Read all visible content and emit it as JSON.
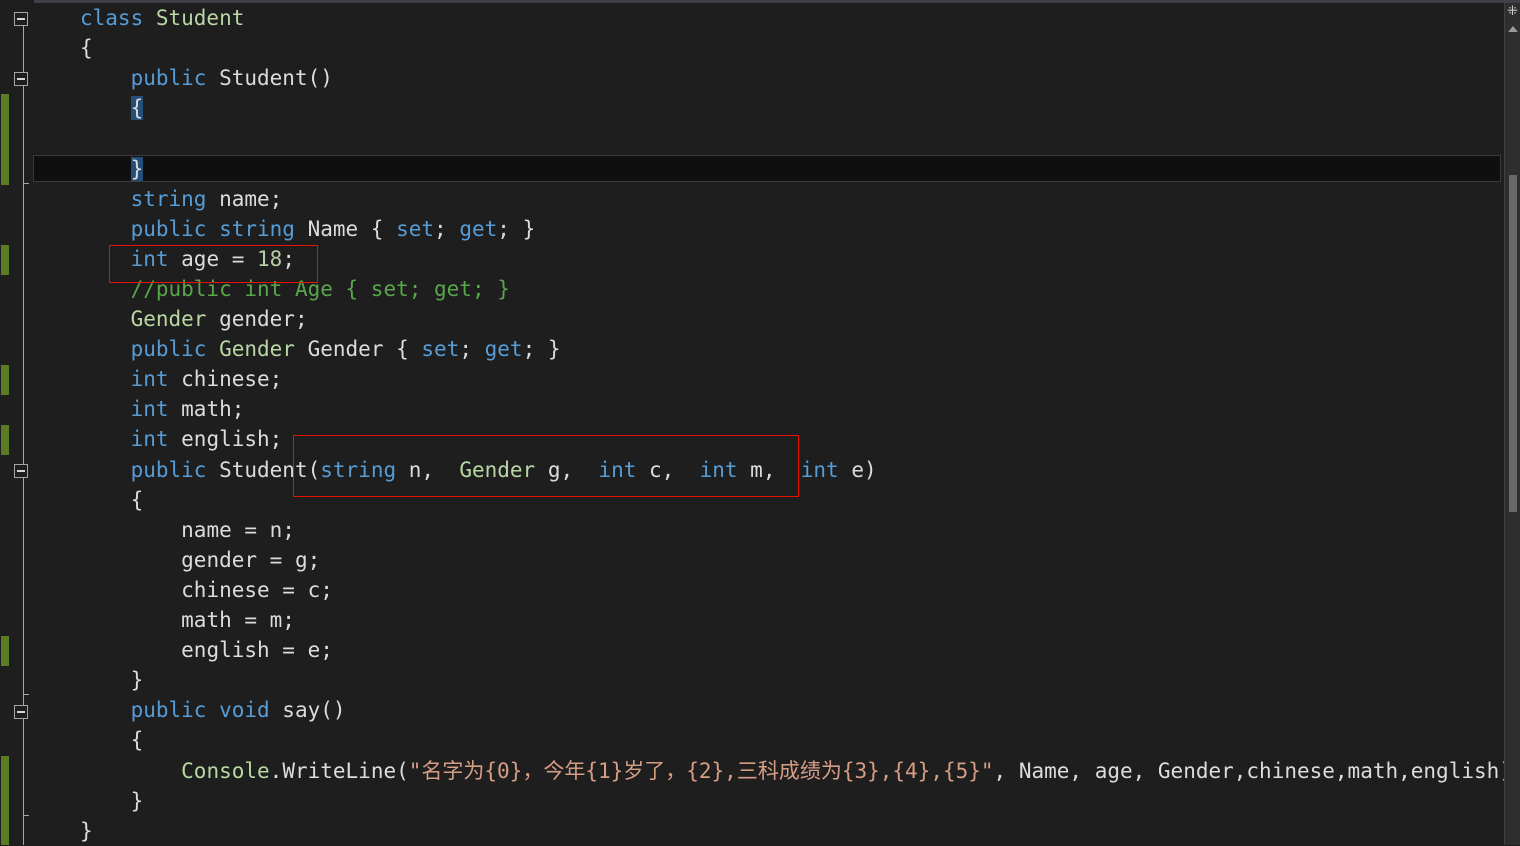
{
  "editor": {
    "lines": [
      [
        {
          "t": "class ",
          "c": "kw"
        },
        {
          "t": "Student",
          "c": "ty"
        }
      ],
      [
        {
          "t": "{",
          "c": "pl"
        }
      ],
      [
        {
          "t": "    "
        },
        {
          "t": "public ",
          "c": "kw"
        },
        {
          "t": "Student()",
          "c": "pl"
        }
      ],
      [
        {
          "t": "    "
        },
        {
          "t": "{",
          "c": "pl",
          "hl": true
        }
      ],
      [],
      [
        {
          "t": "    "
        },
        {
          "t": "}",
          "c": "pl",
          "hl": true
        }
      ],
      [
        {
          "t": "    "
        },
        {
          "t": "string ",
          "c": "kw"
        },
        {
          "t": "name;",
          "c": "pl"
        }
      ],
      [
        {
          "t": "    "
        },
        {
          "t": "public string ",
          "c": "kw"
        },
        {
          "t": "Name { ",
          "c": "pl"
        },
        {
          "t": "set",
          "c": "kw"
        },
        {
          "t": "; ",
          "c": "pl"
        },
        {
          "t": "get",
          "c": "kw"
        },
        {
          "t": "; }",
          "c": "pl"
        }
      ],
      [
        {
          "t": "    "
        },
        {
          "t": "int ",
          "c": "kw"
        },
        {
          "t": "age = ",
          "c": "pl"
        },
        {
          "t": "18",
          "c": "nm"
        },
        {
          "t": ";",
          "c": "pl"
        }
      ],
      [
        {
          "t": "    "
        },
        {
          "t": "//public int Age { set; get; }",
          "c": "cm"
        }
      ],
      [
        {
          "t": "    "
        },
        {
          "t": "Gender ",
          "c": "ty"
        },
        {
          "t": "gender;",
          "c": "pl"
        }
      ],
      [
        {
          "t": "    "
        },
        {
          "t": "public ",
          "c": "kw"
        },
        {
          "t": "Gender ",
          "c": "ty"
        },
        {
          "t": "Gender { ",
          "c": "pl"
        },
        {
          "t": "set",
          "c": "kw"
        },
        {
          "t": "; ",
          "c": "pl"
        },
        {
          "t": "get",
          "c": "kw"
        },
        {
          "t": "; }",
          "c": "pl"
        }
      ],
      [
        {
          "t": "    "
        },
        {
          "t": "int ",
          "c": "kw"
        },
        {
          "t": "chinese;",
          "c": "pl"
        }
      ],
      [
        {
          "t": "    "
        },
        {
          "t": "int ",
          "c": "kw"
        },
        {
          "t": "math;",
          "c": "pl"
        }
      ],
      [
        {
          "t": "    "
        },
        {
          "t": "int ",
          "c": "kw"
        },
        {
          "t": "english;",
          "c": "pl"
        }
      ],
      [
        {
          "t": "    "
        },
        {
          "t": "public ",
          "c": "kw"
        },
        {
          "t": "Student(",
          "c": "pl"
        },
        {
          "t": "string ",
          "c": "kw"
        },
        {
          "t": "n,  ",
          "c": "pl"
        },
        {
          "t": "Gender ",
          "c": "ty"
        },
        {
          "t": "g,  ",
          "c": "pl"
        },
        {
          "t": "int ",
          "c": "kw"
        },
        {
          "t": "c,  ",
          "c": "pl"
        },
        {
          "t": "int ",
          "c": "kw"
        },
        {
          "t": "m,  ",
          "c": "pl"
        },
        {
          "t": "int ",
          "c": "kw"
        },
        {
          "t": "e)",
          "c": "pl"
        }
      ],
      [
        {
          "t": "    "
        },
        {
          "t": "{",
          "c": "pl"
        }
      ],
      [
        {
          "t": "        "
        },
        {
          "t": "name = n;",
          "c": "pl"
        }
      ],
      [
        {
          "t": "        "
        },
        {
          "t": "gender = g;",
          "c": "pl"
        }
      ],
      [
        {
          "t": "        "
        },
        {
          "t": "chinese = c;",
          "c": "pl"
        }
      ],
      [
        {
          "t": "        "
        },
        {
          "t": "math = m;",
          "c": "pl"
        }
      ],
      [
        {
          "t": "        "
        },
        {
          "t": "english = e;",
          "c": "pl"
        }
      ],
      [
        {
          "t": "    "
        },
        {
          "t": "}",
          "c": "pl"
        }
      ],
      [
        {
          "t": "    "
        },
        {
          "t": "public void ",
          "c": "kw"
        },
        {
          "t": "say()",
          "c": "pl"
        }
      ],
      [
        {
          "t": "    "
        },
        {
          "t": "{",
          "c": "pl"
        }
      ],
      [
        {
          "t": "        "
        },
        {
          "t": "Console",
          "c": "ty"
        },
        {
          "t": ".WriteLine(",
          "c": "pl"
        },
        {
          "t": "\"名字为{0}，今年{1}岁了，{2},三科成绩为{3},{4},{5}\"",
          "c": "st"
        },
        {
          "t": ", Name, age, Gender,chinese,math,english);",
          "c": "pl"
        }
      ],
      [
        {
          "t": "    "
        },
        {
          "t": "}",
          "c": "pl"
        }
      ],
      [
        {
          "t": "}",
          "c": "pl"
        }
      ]
    ]
  },
  "scrollbar": {
    "split_glyph": "⁜"
  },
  "colors": {
    "background": "#1e1e1e",
    "keyword": "#569cd6",
    "type": "#b8d7a3",
    "comment": "#57a64a",
    "string": "#d69d85",
    "number": "#b5cea8",
    "plain": "#dcdcdc",
    "annotation_box": "#e51400",
    "change_bar": "#5a7d24"
  }
}
